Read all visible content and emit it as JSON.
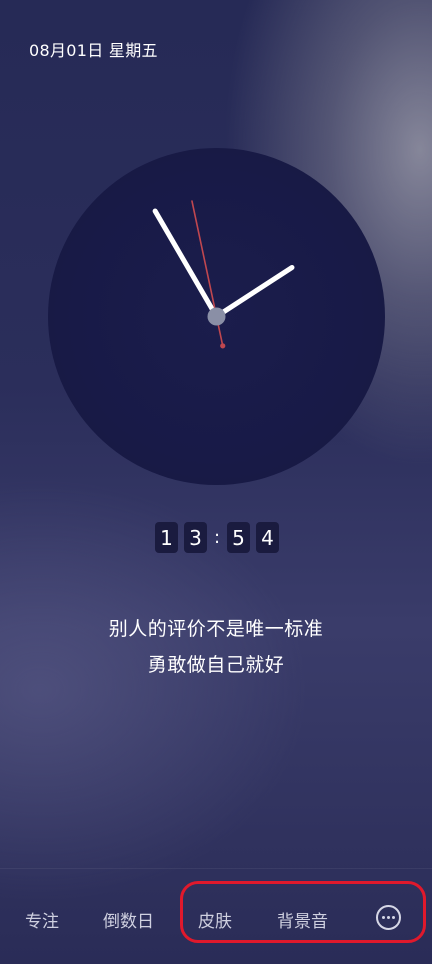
{
  "header": {
    "date": "08月01日 星期五"
  },
  "clock": {
    "time": {
      "hour": 13,
      "minute": 54,
      "second": 58
    },
    "digits": [
      "1",
      "3",
      "5",
      "4"
    ],
    "separator": ":"
  },
  "quote": {
    "line1": "别人的评价不是唯一标准",
    "line2": "勇敢做自己就好"
  },
  "bottom_nav": {
    "items": [
      {
        "label": "专注"
      },
      {
        "label": "倒数日"
      },
      {
        "label": "皮肤"
      },
      {
        "label": "背景音"
      }
    ],
    "more_icon": "more-circle-icon"
  },
  "colors": {
    "second_hand": "#c0474f",
    "hands": "#ffffff",
    "center_cap": "#8a8fa6",
    "highlight": "#e0192c"
  }
}
